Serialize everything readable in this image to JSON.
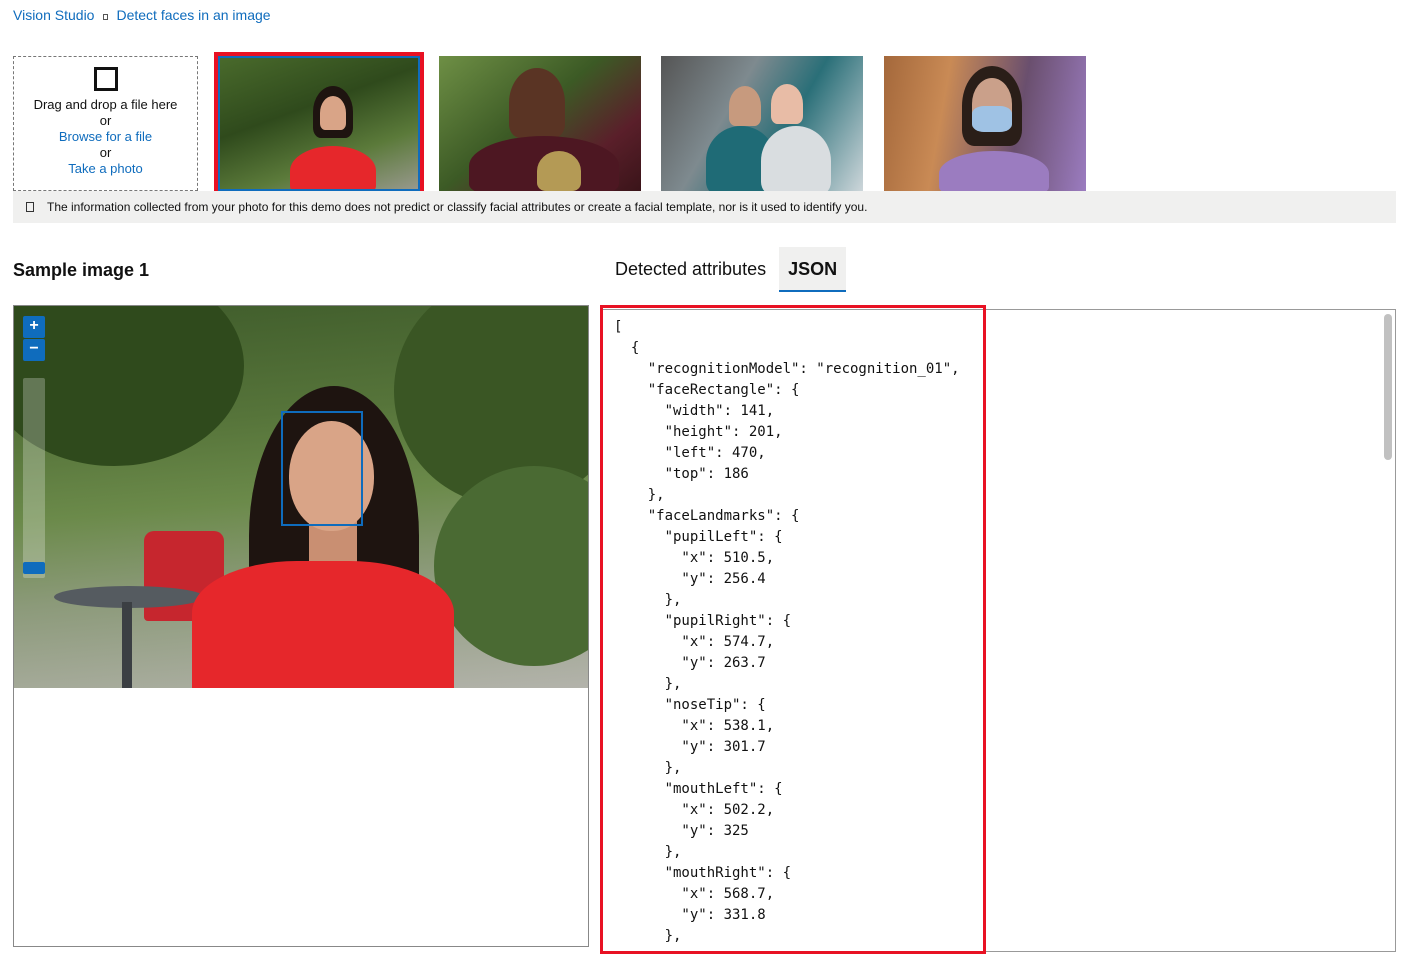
{
  "breadcrumb": {
    "root": "Vision Studio",
    "current": "Detect faces in an image"
  },
  "upload": {
    "drag_text": "Drag and drop a file here",
    "or_1": "or",
    "browse_link": "Browse for a file",
    "or_2": "or",
    "photo_link": "Take a photo"
  },
  "samples": {
    "selected_index": 0,
    "count": 4
  },
  "info_bar": {
    "text": "The information collected from your photo for this demo does not predict or classify facial attributes or create a facial template, nor is it used to identify you."
  },
  "section_title": "Sample image 1",
  "tabs": [
    {
      "label": "Detected attributes",
      "active": false
    },
    {
      "label": "JSON",
      "active": true
    }
  ],
  "viewer": {
    "zoom_in": "+",
    "zoom_out": "−"
  },
  "json_output": {
    "lines": [
      "[",
      "  {",
      "    \"recognitionModel\": \"recognition_01\",",
      "    \"faceRectangle\": {",
      "      \"width\": 141,",
      "      \"height\": 201,",
      "      \"left\": 470,",
      "      \"top\": 186",
      "    },",
      "    \"faceLandmarks\": {",
      "      \"pupilLeft\": {",
      "        \"x\": 510.5,",
      "        \"y\": 256.4",
      "      },",
      "      \"pupilRight\": {",
      "        \"x\": 574.7,",
      "        \"y\": 263.7",
      "      },",
      "      \"noseTip\": {",
      "        \"x\": 538.1,",
      "        \"y\": 301.7",
      "      },",
      "      \"mouthLeft\": {",
      "        \"x\": 502.2,",
      "        \"y\": 325",
      "      },",
      "      \"mouthRight\": {",
      "        \"x\": 568.7,",
      "        \"y\": 331.8",
      "      },"
    ]
  },
  "colors": {
    "link": "#0f6cbd",
    "highlight": "#e81123",
    "info_bg": "#f0f0ef"
  }
}
